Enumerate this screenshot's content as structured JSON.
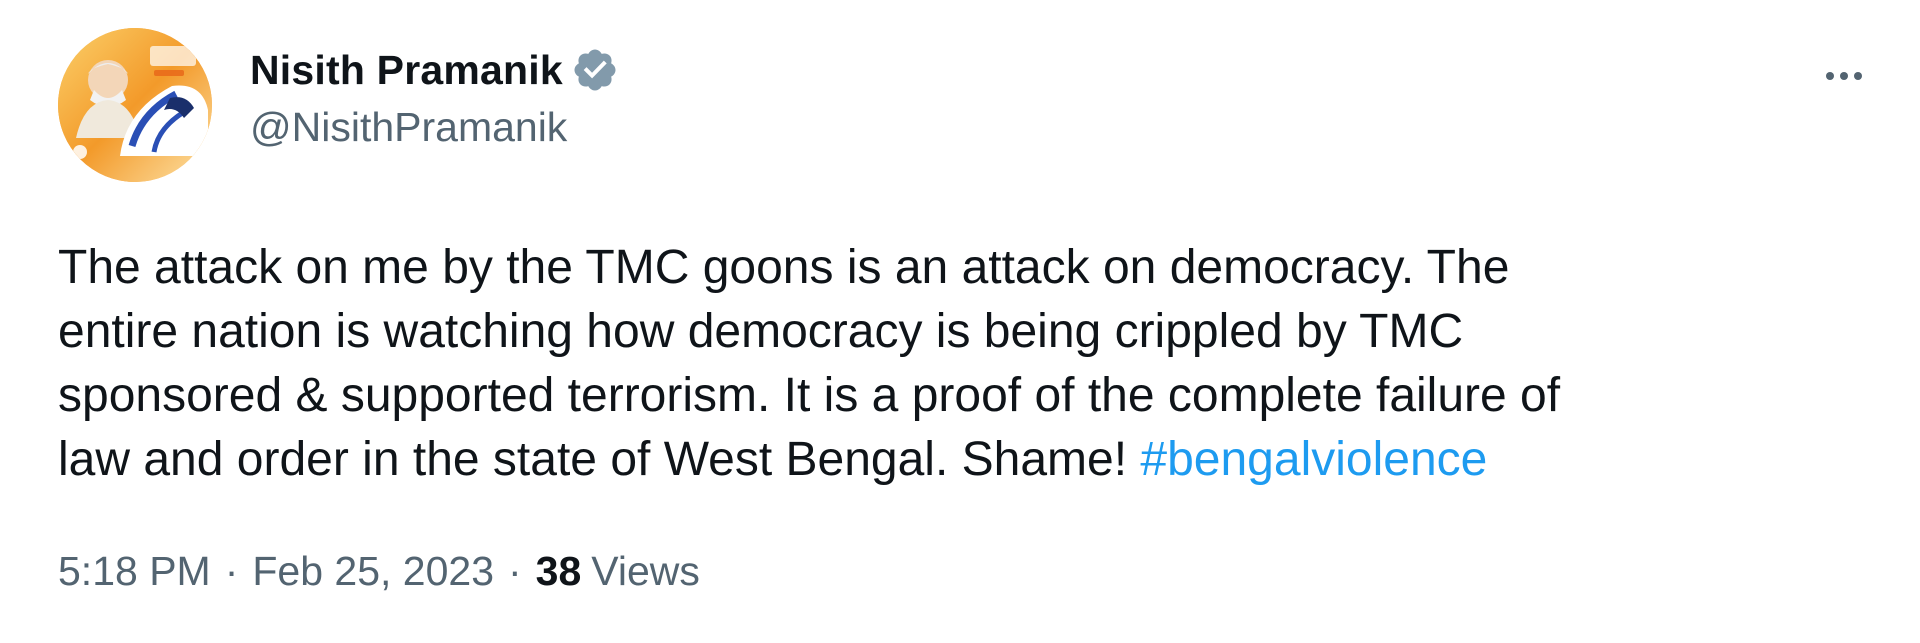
{
  "tweet": {
    "author": {
      "display_name": "Nisith Pramanik",
      "handle": "@NisithPramanik",
      "verified": true,
      "avatar_icon": "profile-photo-with-train"
    },
    "more_icon": "more-options-icon",
    "text_line_1": "The attack on me by the TMC goons is an attack on democracy. The",
    "text_line_2": "entire nation is watching how democracy is being crippled by TMC",
    "text_line_3": "sponsored & supported terrorism. It is a proof of the complete failure of",
    "text_line_4_prefix": "law and order in the state of West Bengal. Shame! ",
    "hashtag": "#bengalviolence",
    "time": "5:18 PM",
    "separator": "·",
    "date": "Feb 25, 2023",
    "views_count": "38",
    "views_label": "Views"
  },
  "colors": {
    "text": "#0f1419",
    "secondary": "#536471",
    "link": "#1d9bf0",
    "verified_badge": "#829aab"
  }
}
